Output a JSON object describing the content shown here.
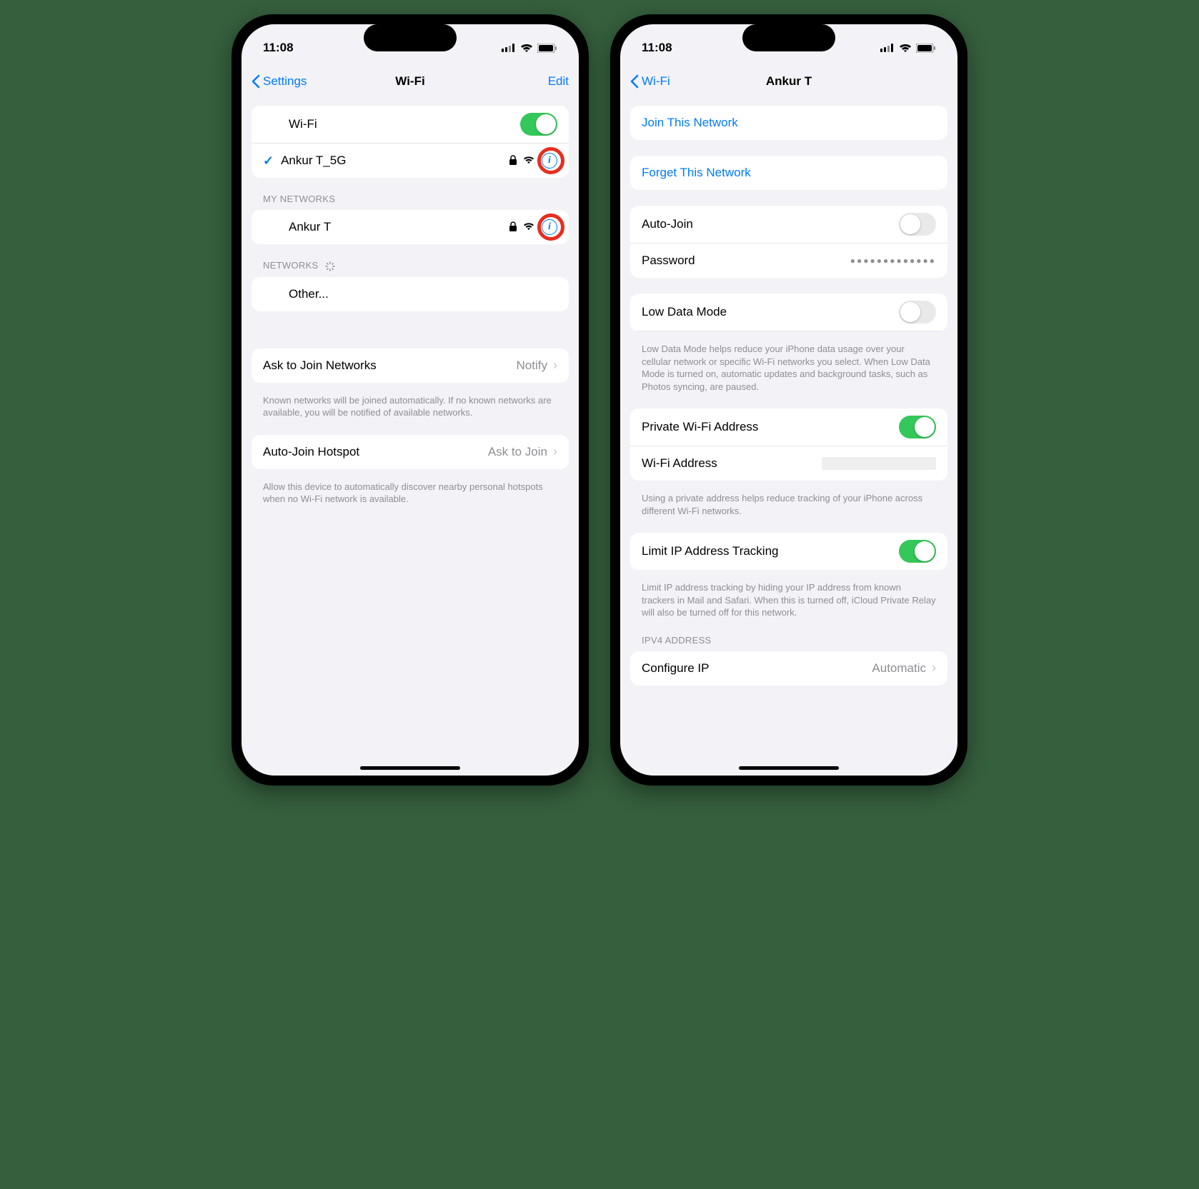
{
  "status": {
    "time": "11:08"
  },
  "left": {
    "nav": {
      "back": "Settings",
      "title": "Wi-Fi",
      "edit": "Edit"
    },
    "wifi_row": "Wi-Fi",
    "connected": "Ankur T_5G",
    "my_networks_header": "MY NETWORKS",
    "network1": "Ankur T",
    "networks_header": "NETWORKS",
    "other": "Other...",
    "ask_join": "Ask to Join Networks",
    "ask_join_value": "Notify",
    "ask_join_footer": "Known networks will be joined automatically. If no known networks are available, you will be notified of available networks.",
    "auto_hotspot": "Auto-Join Hotspot",
    "auto_hotspot_value": "Ask to Join",
    "auto_hotspot_footer": "Allow this device to automatically discover nearby personal hotspots when no Wi-Fi network is available."
  },
  "right": {
    "nav": {
      "back": "Wi-Fi",
      "title": "Ankur T"
    },
    "join": "Join This Network",
    "forget": "Forget This Network",
    "auto_join": "Auto-Join",
    "password": "Password",
    "password_dots": "●●●●●●●●●●●●●",
    "low_data": "Low Data Mode",
    "low_data_footer": "Low Data Mode helps reduce your iPhone data usage over your cellular network or specific Wi-Fi networks you select. When Low Data Mode is turned on, automatic updates and background tasks, such as Photos syncing, are paused.",
    "private_addr": "Private Wi-Fi Address",
    "wifi_addr": "Wi-Fi Address",
    "private_footer": "Using a private address helps reduce tracking of your iPhone across different Wi-Fi networks.",
    "limit_ip": "Limit IP Address Tracking",
    "limit_ip_footer": "Limit IP address tracking by hiding your IP address from known trackers in Mail and Safari. When this is turned off, iCloud Private Relay will also be turned off for this network.",
    "ipv4_header": "IPV4 ADDRESS",
    "configure_ip": "Configure IP",
    "configure_ip_value": "Automatic"
  }
}
